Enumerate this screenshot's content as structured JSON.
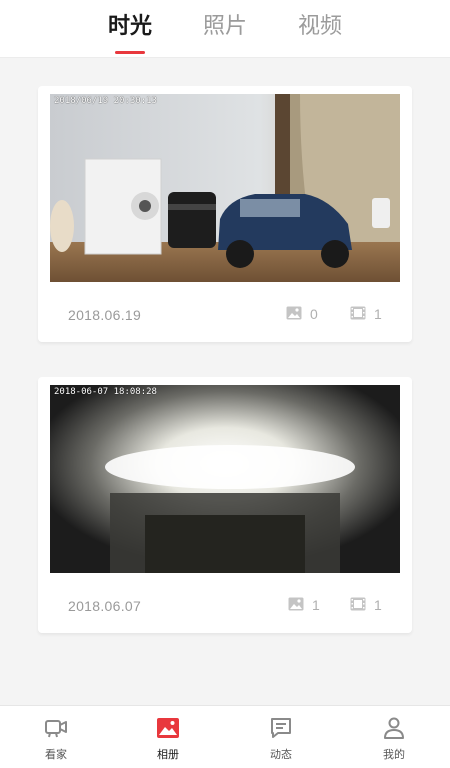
{
  "tabs": [
    {
      "label": "时光",
      "active": true
    },
    {
      "label": "照片",
      "active": false
    },
    {
      "label": "视频",
      "active": false
    }
  ],
  "accent_color": "#e8383d",
  "cards": [
    {
      "timestamp_overlay": "2018/06/19 20:30:13",
      "date": "2018.06.19",
      "photo_count": "0",
      "video_count": "1"
    },
    {
      "timestamp_overlay": "2018-06-07 18:08:28",
      "date": "2018.06.07",
      "photo_count": "1",
      "video_count": "1"
    }
  ],
  "bottom_nav": [
    {
      "label": "看家",
      "icon": "camera-icon",
      "active": false
    },
    {
      "label": "相册",
      "icon": "album-icon",
      "active": true
    },
    {
      "label": "动态",
      "icon": "message-icon",
      "active": false
    },
    {
      "label": "我的",
      "icon": "person-icon",
      "active": false
    }
  ]
}
